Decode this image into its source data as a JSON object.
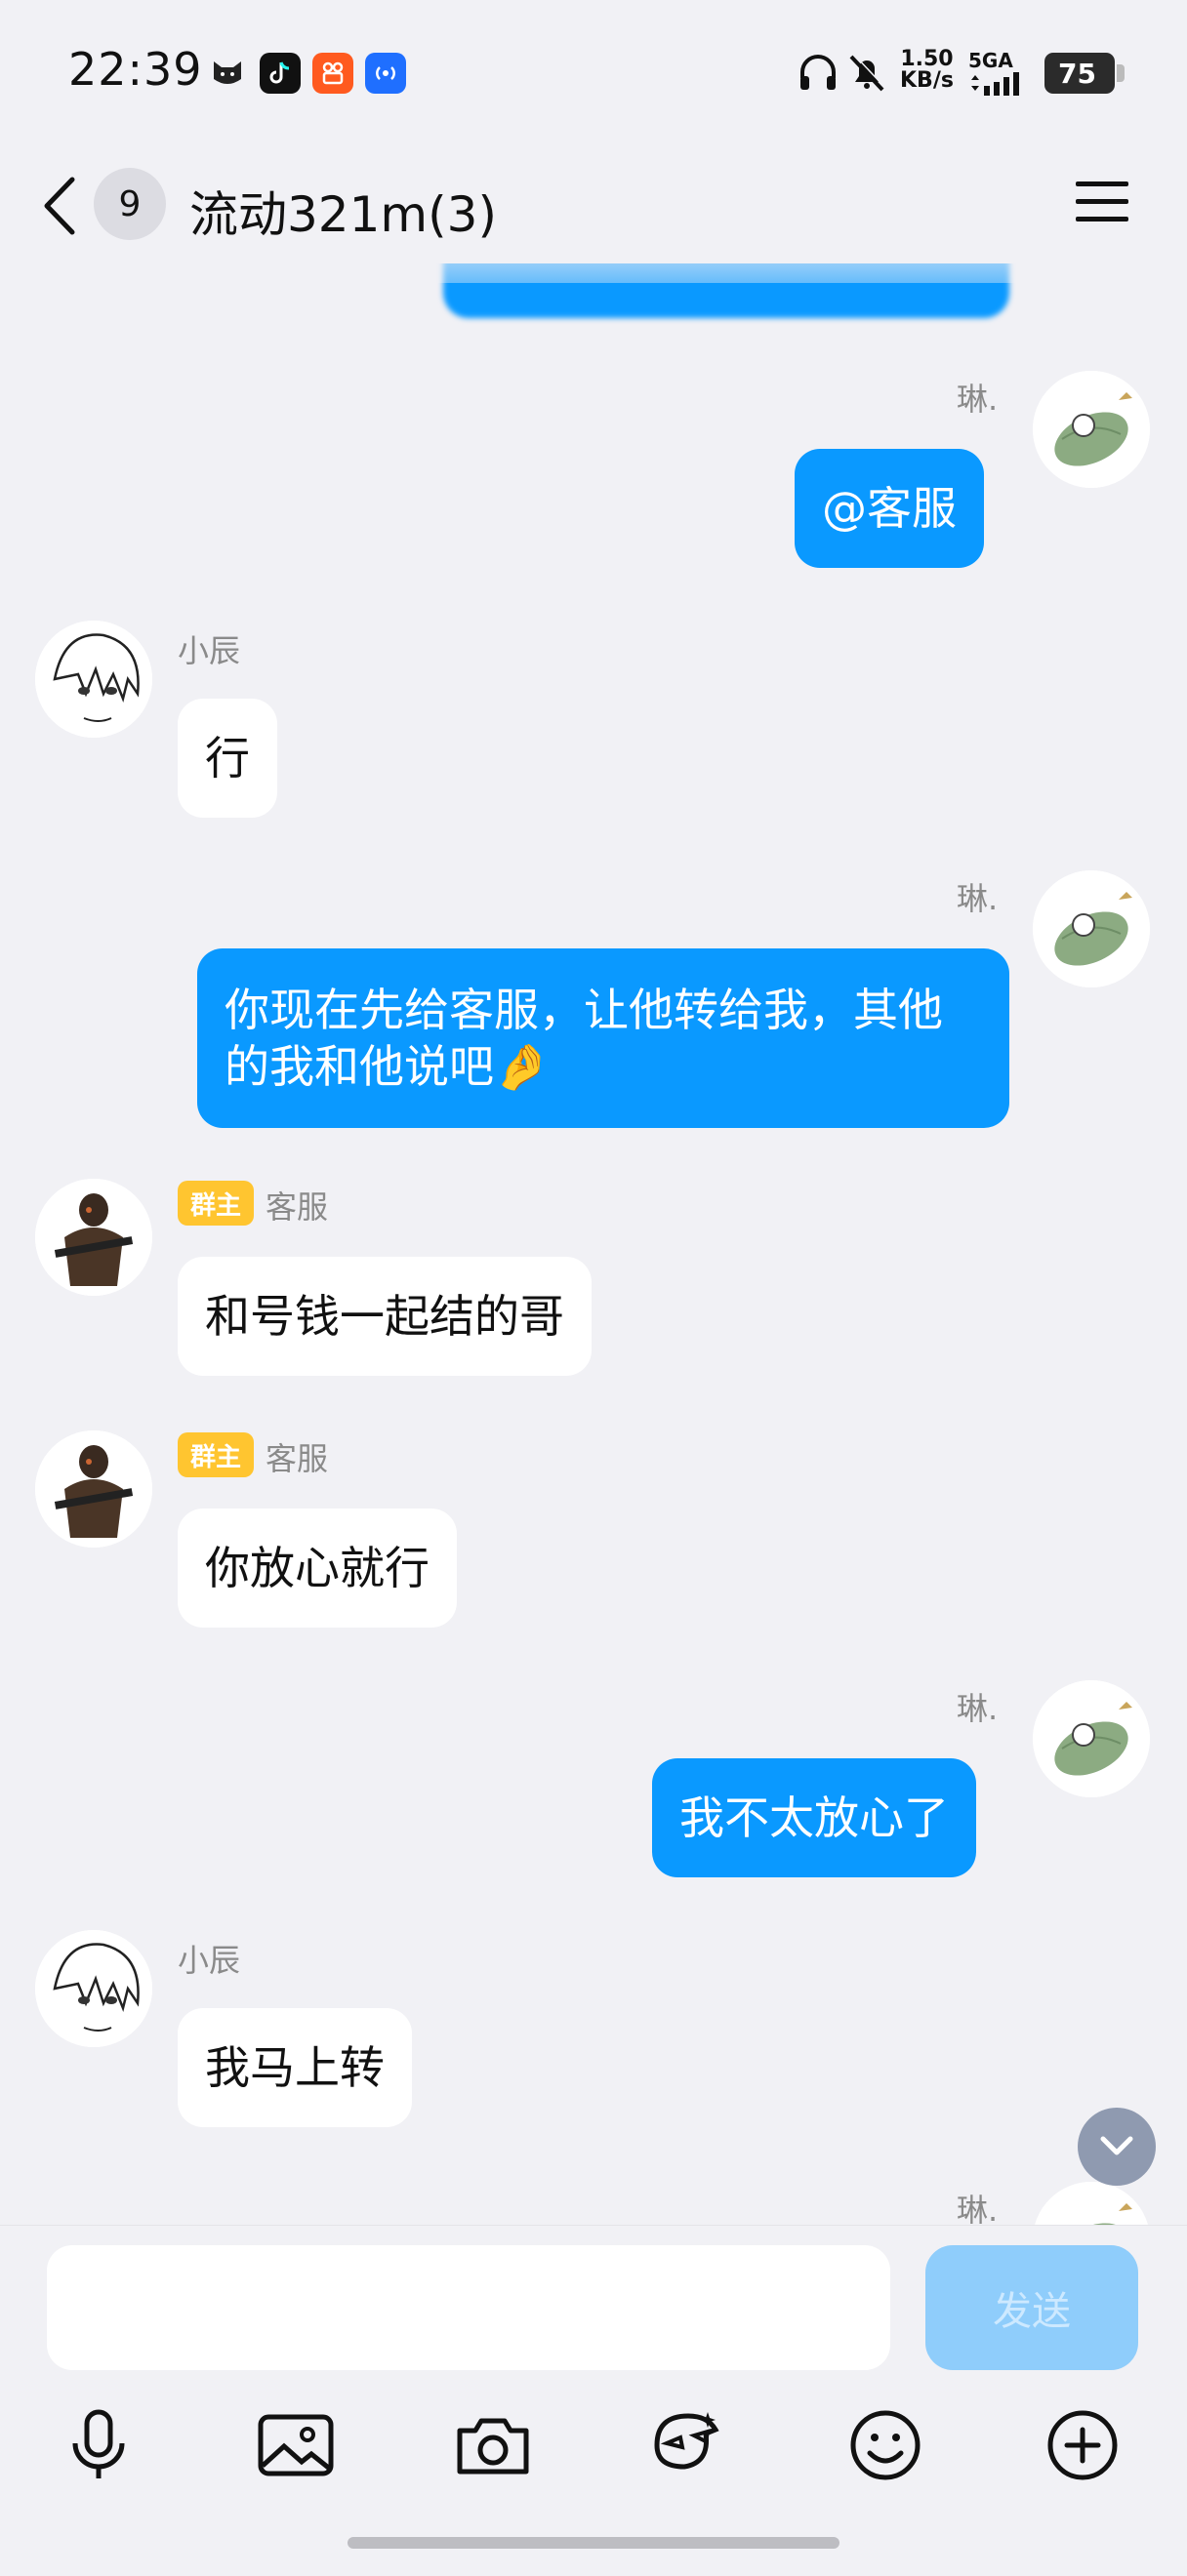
{
  "status_bar": {
    "time": "22:39",
    "speed_value": "1.50",
    "speed_unit": "KB/s",
    "network": "5GA",
    "battery": "75",
    "icons": [
      "cat-app-icon",
      "tiktok-icon",
      "kuaishou-icon",
      "broadcast-icon",
      "headphones-icon",
      "bell-muted-icon",
      "signal-icon"
    ]
  },
  "header": {
    "unread_count": "9",
    "title": "流动321m(3)"
  },
  "messages": [
    {
      "side": "out",
      "text": ""
    },
    {
      "side": "out",
      "sender": "琳.",
      "text": "@客服"
    },
    {
      "side": "in",
      "sender": "小辰",
      "text": "行"
    },
    {
      "side": "out",
      "sender": "琳.",
      "text": "你现在先给客服，让他转给我，其他的我和他说吧🤌"
    },
    {
      "side": "in",
      "sender": "客服",
      "role_badge": "群主",
      "text": "和号钱一起结的哥"
    },
    {
      "side": "in",
      "sender": "客服",
      "role_badge": "群主",
      "text": "你放心就行"
    },
    {
      "side": "out",
      "sender": "琳.",
      "text": "我不太放心了"
    },
    {
      "side": "in",
      "sender": "小辰",
      "text": "我马上转"
    },
    {
      "side": "out",
      "sender": "琳.",
      "text": ""
    }
  ],
  "input": {
    "placeholder": "",
    "send_label": "发送"
  },
  "toolbar": [
    "microphone-icon",
    "image-icon",
    "camera-icon",
    "sticker-icon",
    "emoji-icon",
    "plus-icon"
  ],
  "colors": {
    "background": "#f1f1f5",
    "outgoing_bubble": "#0a99ff",
    "incoming_bubble": "#ffffff",
    "owner_badge": "#ffc530",
    "send_button": "#8fcdfb"
  }
}
